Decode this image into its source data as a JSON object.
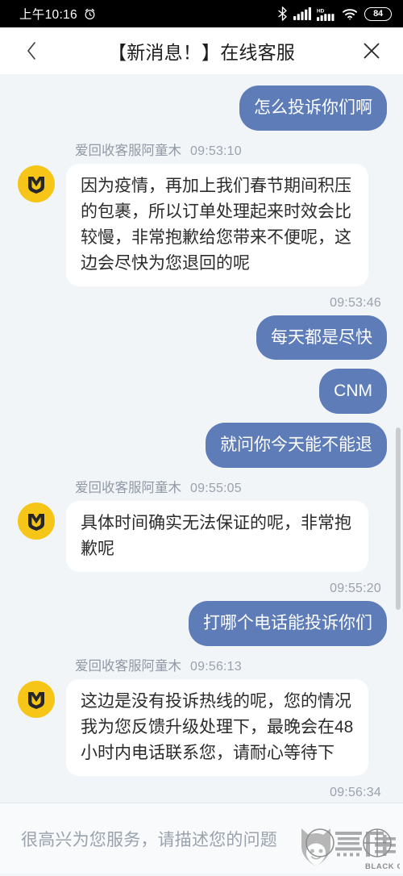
{
  "statusbar": {
    "time": "上午10:16",
    "alarm_icon": "alarm-clock-icon",
    "bluetooth_icon": "bluetooth-icon",
    "signal_icon": "cellular-signal-icon",
    "hd_label": "HD",
    "hd_signal_icon": "hd-cellular-signal-icon",
    "wifi_icon": "wifi-icon",
    "battery_level": "84"
  },
  "header": {
    "back_icon": "chevron-left-icon",
    "title": "【新消息！】在线客服",
    "close_icon": "close-icon"
  },
  "agent": {
    "name": "爱回收客服阿童木",
    "avatar_icon": "aihuishou-logo-icon"
  },
  "messages": [
    {
      "side": "out",
      "text": "怎么投诉你们啊",
      "time": ""
    },
    {
      "side": "in",
      "sender": "爱回收客服阿童木",
      "time": "09:53:10",
      "text": "因为疫情，再加上我们春节期间积压的包裹，所以订单处理起来时效会比较慢，非常抱歉给您带来不便呢，这边会尽快为您退回的呢"
    },
    {
      "side": "out",
      "time": "09:53:46",
      "text": "每天都是尽快"
    },
    {
      "side": "out",
      "text": "CNM"
    },
    {
      "side": "out",
      "text": "就问你今天能不能退"
    },
    {
      "side": "in",
      "sender": "爱回收客服阿童木",
      "time": "09:55:05",
      "text": "具体时间确实无法保证的呢，非常抱歉呢"
    },
    {
      "side": "out",
      "time": "09:55:20",
      "text": "打哪个电话能投诉你们"
    },
    {
      "side": "in",
      "sender": "爱回收客服阿童木",
      "time": "09:56:13",
      "text": "这边是没有投诉热线的呢，您的情况我为您反馈升级处理下，最晚会在48小时内电话联系您，请耐心等待下"
    },
    {
      "side": "out",
      "time": "09:56:34",
      "text": ""
    }
  ],
  "footer": {
    "placeholder": "很高兴为您服务，请描述您的问题",
    "watermark_icon": "black-cat-watermark-icon",
    "watermark_cn": "黑猫",
    "watermark_en": "BLACK CAT"
  },
  "colors": {
    "outgoing_bubble": "#5d7cb8",
    "incoming_bubble": "#ffffff",
    "chat_background": "#f2f5f8",
    "avatar": "#f5c518",
    "status_bar": "#000000"
  }
}
